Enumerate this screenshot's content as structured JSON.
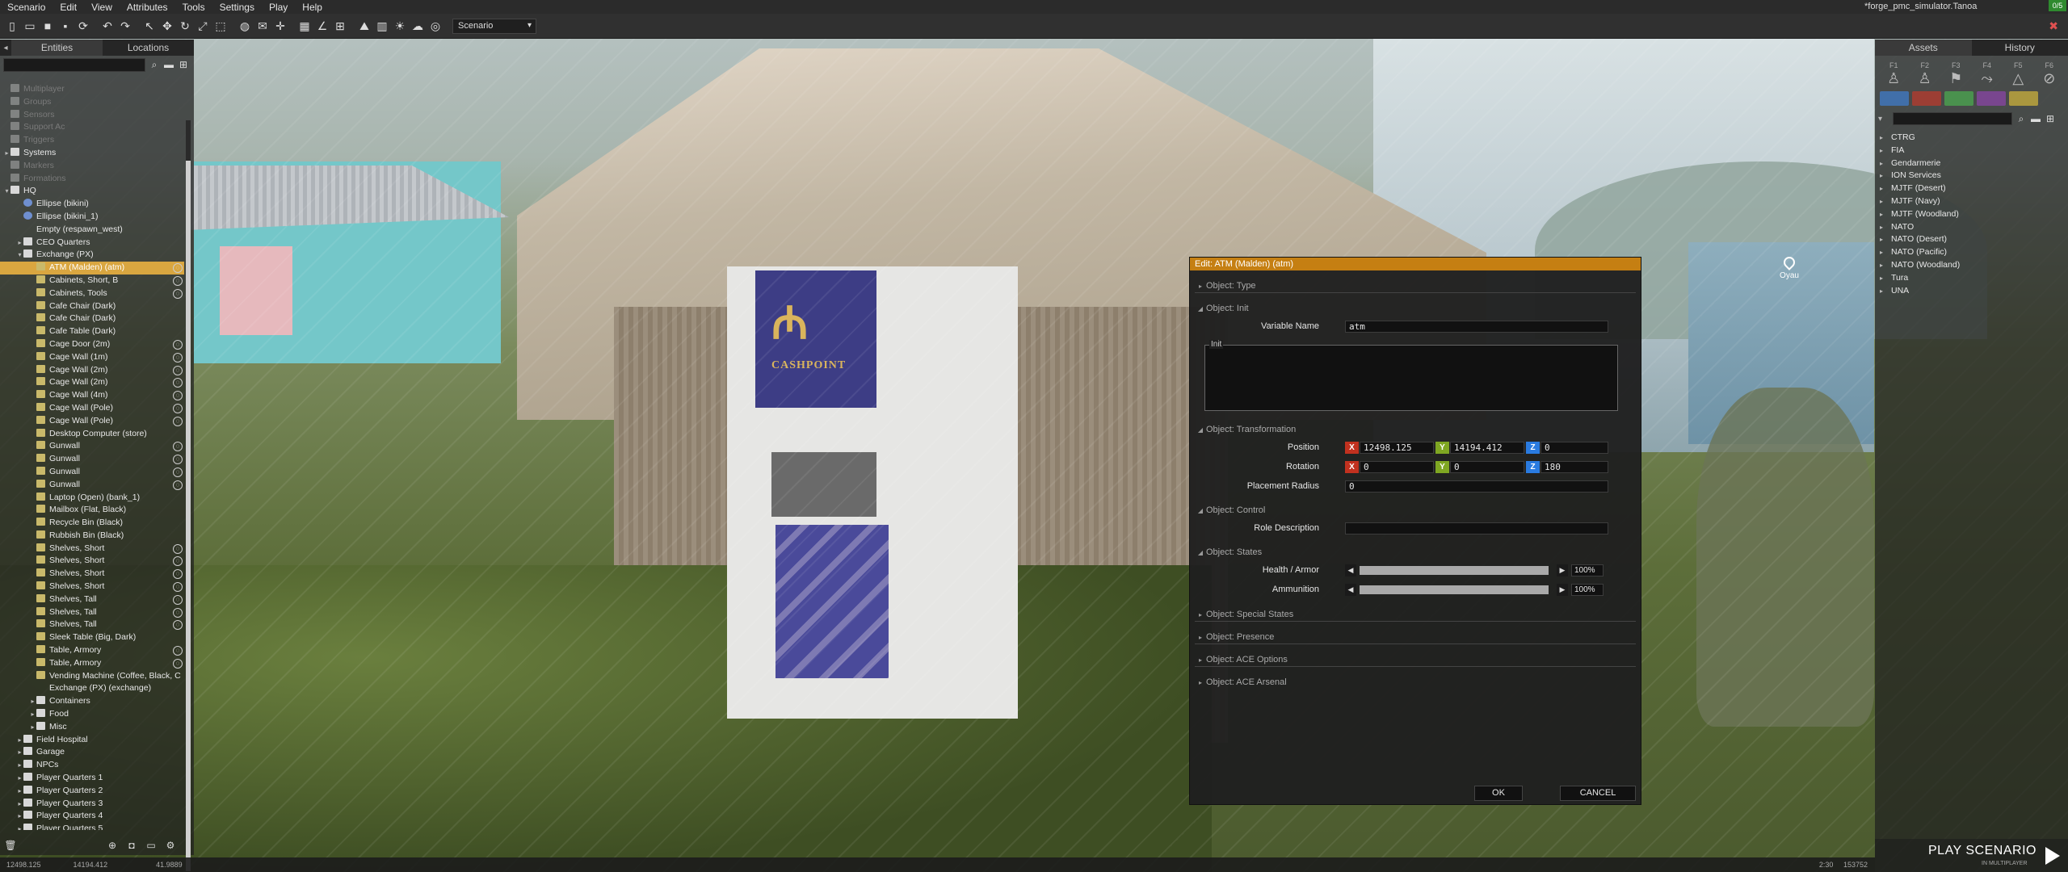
{
  "menu": {
    "items": [
      "Scenario",
      "Edit",
      "View",
      "Attributes",
      "Tools",
      "Settings",
      "Play",
      "Help"
    ],
    "window_title": "*forge_pmc_simulator.Tanoa",
    "notification": "0/5"
  },
  "toolbar": {
    "scenario_select": "Scenario"
  },
  "left_panel": {
    "tabs": [
      "Entities",
      "Locations"
    ],
    "active_tab": "Entities",
    "rows": [
      {
        "label": "Multiplayer",
        "indent": 0,
        "icon": "folder",
        "dim": true,
        "twist": ""
      },
      {
        "label": "Groups",
        "indent": 0,
        "icon": "folder",
        "dim": true,
        "twist": ""
      },
      {
        "label": "Sensors",
        "indent": 0,
        "icon": "folder",
        "dim": true,
        "twist": ""
      },
      {
        "label": "Support Ac",
        "indent": 0,
        "icon": "folder",
        "dim": true,
        "twist": ""
      },
      {
        "label": "Triggers",
        "indent": 0,
        "icon": "folder",
        "dim": true,
        "twist": ""
      },
      {
        "label": "Systems",
        "indent": 0,
        "icon": "folder",
        "dim": false,
        "twist": "▸"
      },
      {
        "label": "Markers",
        "indent": 0,
        "icon": "folder",
        "dim": true,
        "twist": ""
      },
      {
        "label": "Formations",
        "indent": 0,
        "icon": "folder",
        "dim": true,
        "twist": ""
      },
      {
        "label": "HQ",
        "indent": 0,
        "icon": "folder",
        "dim": false,
        "twist": "▾"
      },
      {
        "label": "Ellipse (bikini)",
        "indent": 1,
        "icon": "ell",
        "dim": false,
        "twist": ""
      },
      {
        "label": "Ellipse (bikini_1)",
        "indent": 1,
        "icon": "ell",
        "dim": false,
        "twist": ""
      },
      {
        "label": "Empty (respawn_west)",
        "indent": 1,
        "icon": "emp",
        "dim": false,
        "twist": ""
      },
      {
        "label": "CEO Quarters",
        "indent": 1,
        "icon": "folder",
        "dim": false,
        "twist": "▸"
      },
      {
        "label": "Exchange (PX)",
        "indent": 1,
        "icon": "folder",
        "dim": false,
        "twist": "▾"
      },
      {
        "label": "ATM (Malden) (atm)",
        "indent": 2,
        "icon": "obj",
        "dim": false,
        "twist": "",
        "selected": true,
        "badge": true
      },
      {
        "label": "Cabinets, Short, B",
        "indent": 2,
        "icon": "obj",
        "dim": false,
        "twist": "",
        "badge": true
      },
      {
        "label": "Cabinets, Tools",
        "indent": 2,
        "icon": "obj",
        "dim": false,
        "twist": "",
        "badge": true
      },
      {
        "label": "Cafe Chair (Dark)",
        "indent": 2,
        "icon": "obj",
        "dim": false,
        "twist": ""
      },
      {
        "label": "Cafe Chair (Dark)",
        "indent": 2,
        "icon": "obj",
        "dim": false,
        "twist": ""
      },
      {
        "label": "Cafe Table (Dark)",
        "indent": 2,
        "icon": "obj",
        "dim": false,
        "twist": ""
      },
      {
        "label": "Cage Door (2m)",
        "indent": 2,
        "icon": "obj",
        "dim": false,
        "twist": "",
        "badge": true
      },
      {
        "label": "Cage Wall (1m)",
        "indent": 2,
        "icon": "obj",
        "dim": false,
        "twist": "",
        "badge": true
      },
      {
        "label": "Cage Wall (2m)",
        "indent": 2,
        "icon": "obj",
        "dim": false,
        "twist": "",
        "badge": true
      },
      {
        "label": "Cage Wall (2m)",
        "indent": 2,
        "icon": "obj",
        "dim": false,
        "twist": "",
        "badge": true
      },
      {
        "label": "Cage Wall (4m)",
        "indent": 2,
        "icon": "obj",
        "dim": false,
        "twist": "",
        "badge": true
      },
      {
        "label": "Cage Wall (Pole)",
        "indent": 2,
        "icon": "obj",
        "dim": false,
        "twist": "",
        "badge": true
      },
      {
        "label": "Cage Wall (Pole)",
        "indent": 2,
        "icon": "obj",
        "dim": false,
        "twist": "",
        "badge": true
      },
      {
        "label": "Desktop Computer (store)",
        "indent": 2,
        "icon": "obj",
        "dim": false,
        "twist": ""
      },
      {
        "label": "Gunwall",
        "indent": 2,
        "icon": "obj",
        "dim": false,
        "twist": "",
        "badge": true
      },
      {
        "label": "Gunwall",
        "indent": 2,
        "icon": "obj",
        "dim": false,
        "twist": "",
        "badge": true
      },
      {
        "label": "Gunwall",
        "indent": 2,
        "icon": "obj",
        "dim": false,
        "twist": "",
        "badge": true
      },
      {
        "label": "Gunwall",
        "indent": 2,
        "icon": "obj",
        "dim": false,
        "twist": "",
        "badge": true
      },
      {
        "label": "Laptop (Open) (bank_1)",
        "indent": 2,
        "icon": "obj",
        "dim": false,
        "twist": ""
      },
      {
        "label": "Mailbox (Flat, Black)",
        "indent": 2,
        "icon": "obj",
        "dim": false,
        "twist": ""
      },
      {
        "label": "Recycle Bin (Black)",
        "indent": 2,
        "icon": "obj",
        "dim": false,
        "twist": ""
      },
      {
        "label": "Rubbish Bin (Black)",
        "indent": 2,
        "icon": "obj",
        "dim": false,
        "twist": ""
      },
      {
        "label": "Shelves, Short",
        "indent": 2,
        "icon": "obj",
        "dim": false,
        "twist": "",
        "badge": true
      },
      {
        "label": "Shelves, Short",
        "indent": 2,
        "icon": "obj",
        "dim": false,
        "twist": "",
        "badge": true
      },
      {
        "label": "Shelves, Short",
        "indent": 2,
        "icon": "obj",
        "dim": false,
        "twist": "",
        "badge": true
      },
      {
        "label": "Shelves, Short",
        "indent": 2,
        "icon": "obj",
        "dim": false,
        "twist": "",
        "badge": true
      },
      {
        "label": "Shelves, Tall",
        "indent": 2,
        "icon": "obj",
        "dim": false,
        "twist": "",
        "badge": true
      },
      {
        "label": "Shelves, Tall",
        "indent": 2,
        "icon": "obj",
        "dim": false,
        "twist": "",
        "badge": true
      },
      {
        "label": "Shelves, Tall",
        "indent": 2,
        "icon": "obj",
        "dim": false,
        "twist": "",
        "badge": true
      },
      {
        "label": "Sleek Table (Big, Dark)",
        "indent": 2,
        "icon": "obj",
        "dim": false,
        "twist": ""
      },
      {
        "label": "Table, Armory",
        "indent": 2,
        "icon": "obj",
        "dim": false,
        "twist": "",
        "badge": true
      },
      {
        "label": "Table, Armory",
        "indent": 2,
        "icon": "obj",
        "dim": false,
        "twist": "",
        "badge": true
      },
      {
        "label": "Vending Machine (Coffee, Black, C",
        "indent": 2,
        "icon": "obj",
        "dim": false,
        "twist": ""
      },
      {
        "label": "Exchange (PX) (exchange)",
        "indent": 2,
        "icon": "emp",
        "dim": false,
        "twist": ""
      },
      {
        "label": "Containers",
        "indent": 2,
        "icon": "folder",
        "dim": false,
        "twist": "▸"
      },
      {
        "label": "Food",
        "indent": 2,
        "icon": "folder",
        "dim": false,
        "twist": "▸"
      },
      {
        "label": "Misc",
        "indent": 2,
        "icon": "folder",
        "dim": false,
        "twist": "▸"
      },
      {
        "label": "Field Hospital",
        "indent": 1,
        "icon": "folder",
        "dim": false,
        "twist": "▸"
      },
      {
        "label": "Garage",
        "indent": 1,
        "icon": "folder",
        "dim": false,
        "twist": "▸"
      },
      {
        "label": "NPCs",
        "indent": 1,
        "icon": "folder",
        "dim": false,
        "twist": "▸"
      },
      {
        "label": "Player Quarters 1",
        "indent": 1,
        "icon": "folder",
        "dim": false,
        "twist": "▸"
      },
      {
        "label": "Player Quarters 2",
        "indent": 1,
        "icon": "folder",
        "dim": false,
        "twist": "▸"
      },
      {
        "label": "Player Quarters 3",
        "indent": 1,
        "icon": "folder",
        "dim": false,
        "twist": "▸"
      },
      {
        "label": "Player Quarters 4",
        "indent": 1,
        "icon": "folder",
        "dim": false,
        "twist": "▸"
      },
      {
        "label": "Player Quarters 5",
        "indent": 1,
        "icon": "folder",
        "dim": false,
        "twist": "▸"
      }
    ]
  },
  "right_panel": {
    "tabs": [
      "Assets",
      "History"
    ],
    "active_tab": "Assets",
    "mode_keys": [
      "F1",
      "F2",
      "F3",
      "F4",
      "F5",
      "F6"
    ],
    "side_colors": [
      "#3f7fd1",
      "#c0392b",
      "#4caf50",
      "#8e44ad",
      "#d4b83a"
    ],
    "factions": [
      "CTRG",
      "FIA",
      "Gendarmerie",
      "ION Services",
      "MJTF (Desert)",
      "MJTF (Navy)",
      "MJTF (Woodland)",
      "NATO",
      "NATO (Desert)",
      "NATO (Pacific)",
      "NATO (Woodland)",
      "Tura",
      "UNA"
    ]
  },
  "viewport": {
    "atm_sign": "CASHPOINT",
    "marker_label": "Oyau"
  },
  "dialog": {
    "title": "Edit: ATM (Malden) (atm)",
    "sections": {
      "type": "Object: Type",
      "init": "Object: Init",
      "transformation": "Object: Transformation",
      "control": "Object: Control",
      "states": "Object: States",
      "special": "Object: Special States",
      "presence": "Object: Presence",
      "ace_options": "Object: ACE Options",
      "ace_arsenal": "Object: ACE Arsenal"
    },
    "variable_name_label": "Variable Name",
    "variable_name": "atm",
    "init_label": "Init",
    "position_label": "Position",
    "position": {
      "x": "12498.125",
      "y": "14194.412",
      "z": "0"
    },
    "rotation_label": "Rotation",
    "rotation": {
      "x": "0",
      "y": "0",
      "z": "180"
    },
    "axis_x": "X",
    "axis_y": "Y",
    "axis_z": "Z",
    "placement_radius_label": "Placement Radius",
    "placement_radius": "0",
    "role_description_label": "Role Description",
    "role_description": "",
    "health_label": "Health / Armor",
    "health_value": 1.0,
    "health_text": "100%",
    "ammo_label": "Ammunition",
    "ammo_value": 1.0,
    "ammo_text": "100%",
    "ok": "OK",
    "cancel": "CANCEL"
  },
  "play": {
    "label": "PLAY SCENARIO",
    "sub": "IN MULTIPLAYER"
  },
  "status": {
    "x": "12498.125",
    "y": "14194.412",
    "z": "41.9889",
    "time": "2:30",
    "right": "153752"
  }
}
